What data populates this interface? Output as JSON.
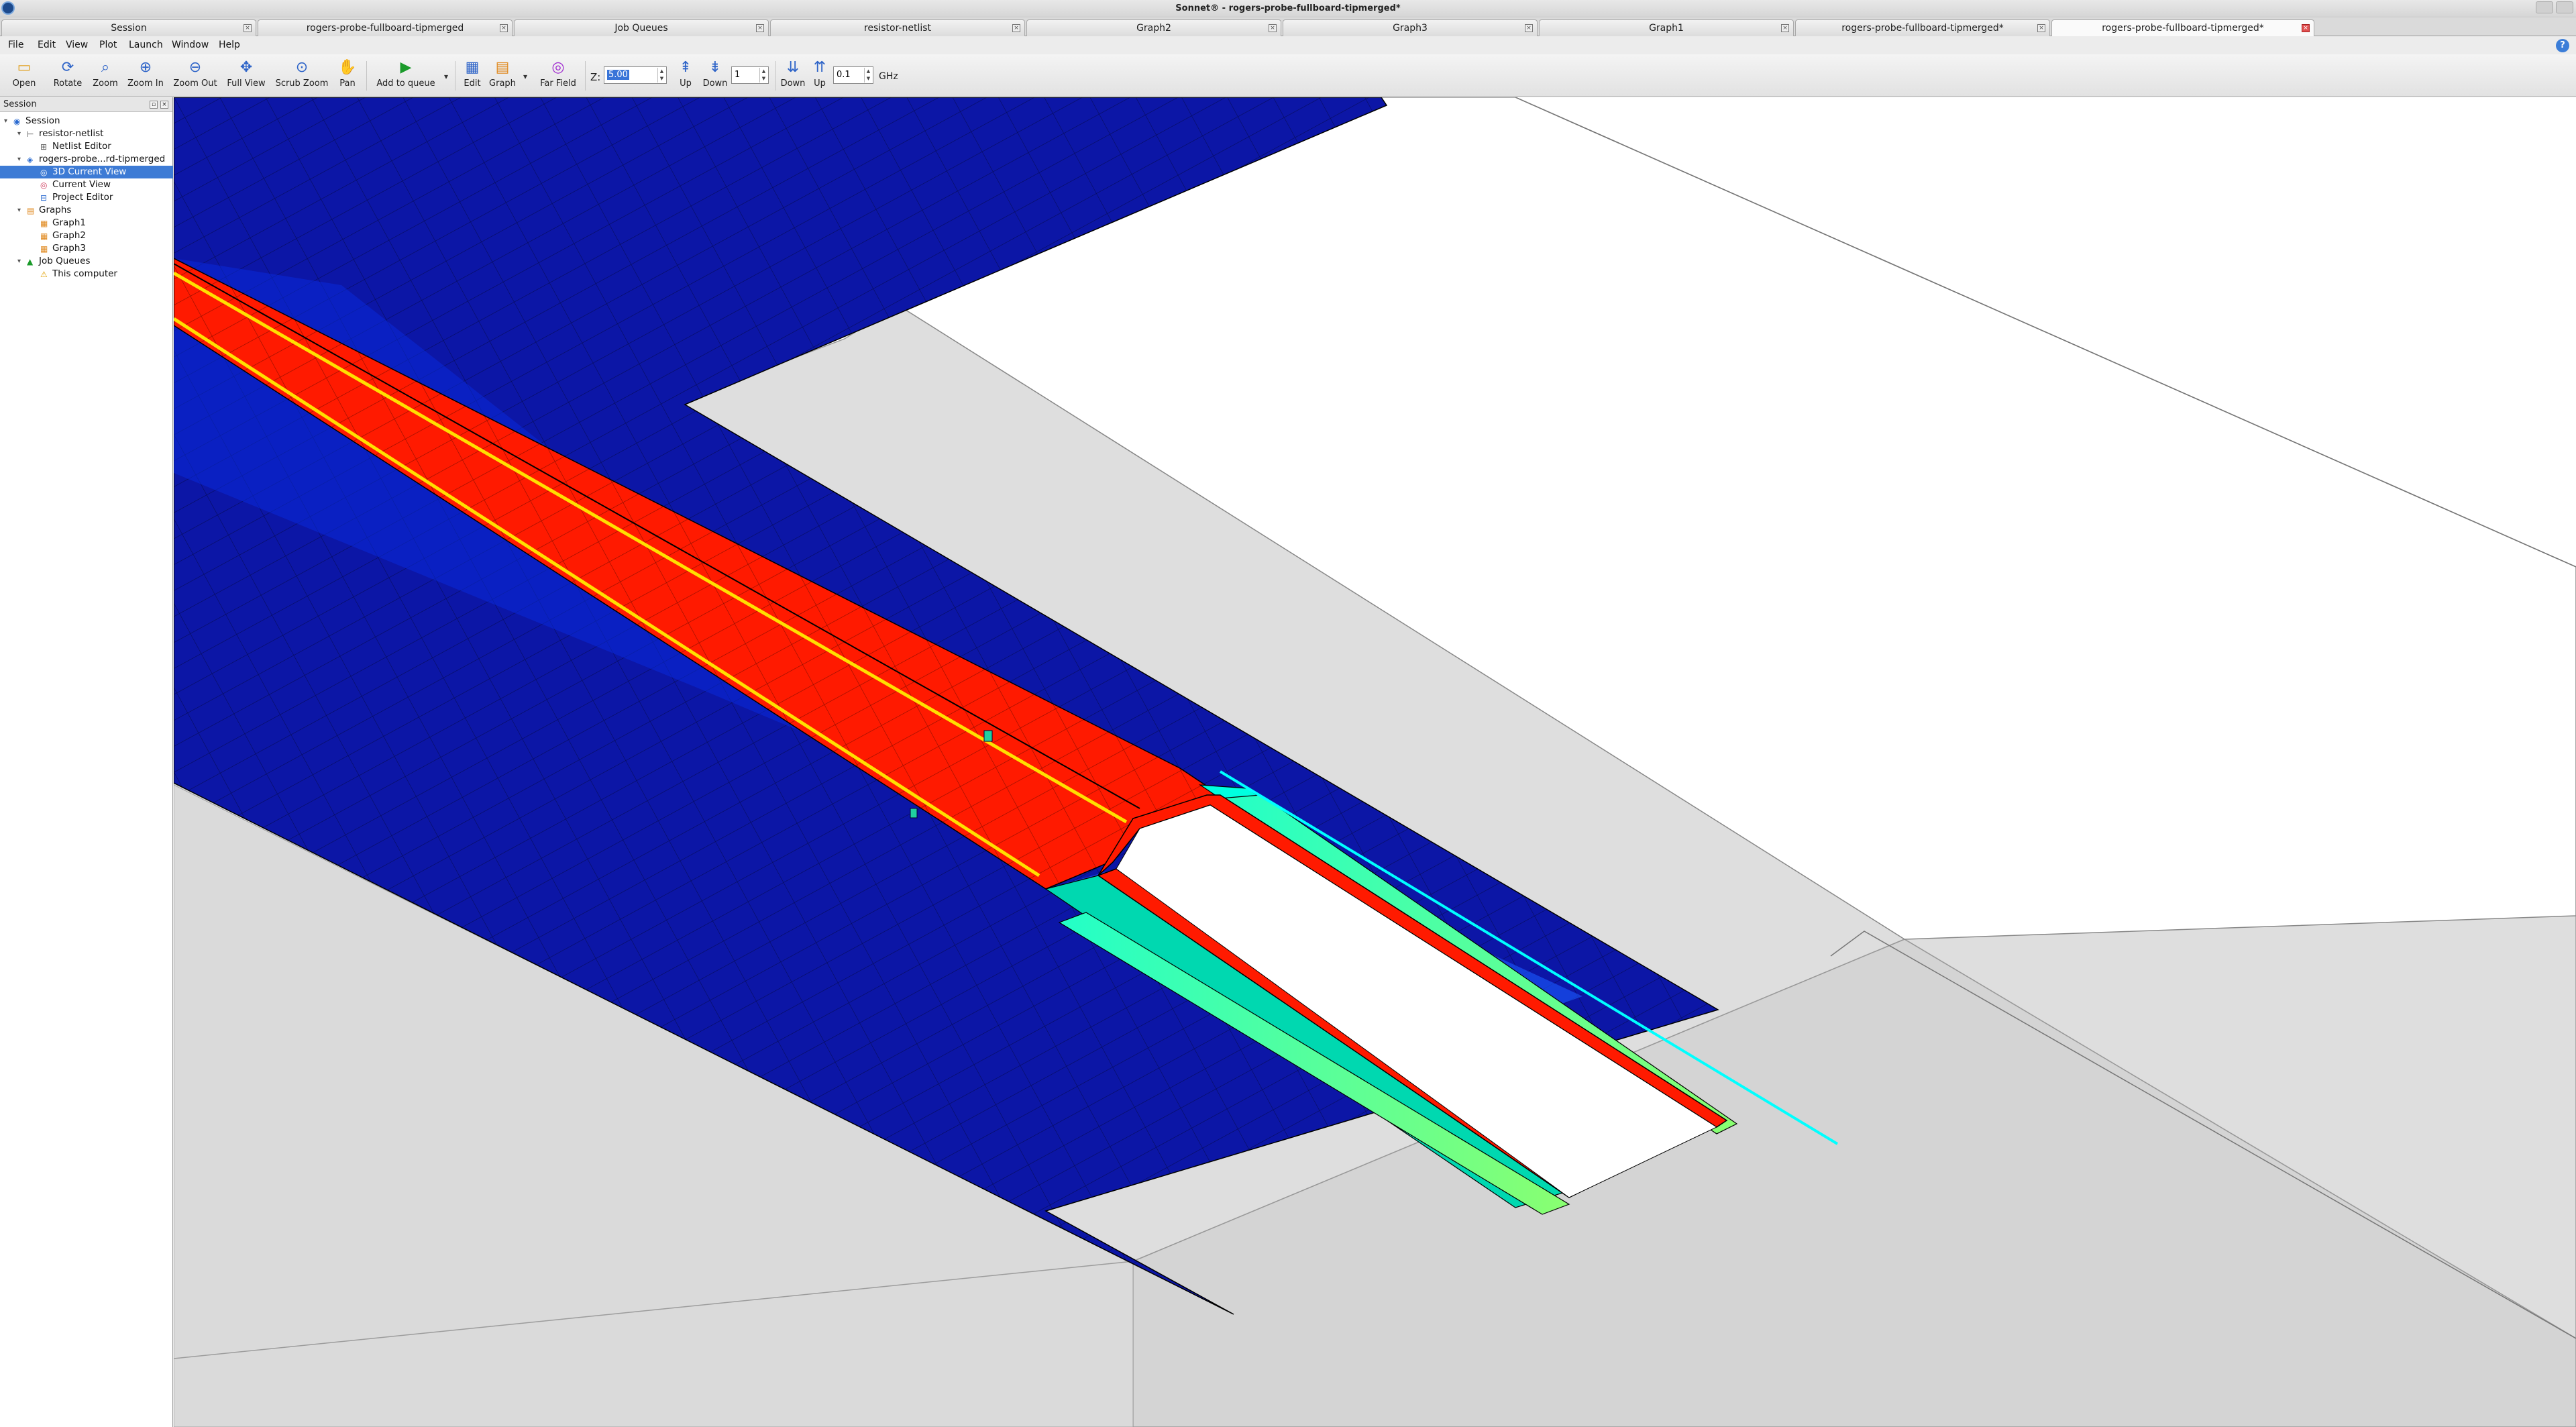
{
  "window": {
    "title": "Sonnet® - rogers-probe-fullboard-tipmerged*"
  },
  "tabs": [
    {
      "label": "Session",
      "icon": "session-icon"
    },
    {
      "label": "rogers-probe-fullboard-tipmerged",
      "icon": "netlist-icon"
    },
    {
      "label": "Job Queues",
      "icon": "job-queue-icon"
    },
    {
      "label": "resistor-netlist",
      "icon": "netlist-icon"
    },
    {
      "label": "Graph2",
      "icon": "graph-icon"
    },
    {
      "label": "Graph3",
      "icon": "graph-icon"
    },
    {
      "label": "Graph1",
      "icon": "graph-icon"
    },
    {
      "label": "rogers-probe-fullboard-tipmerged*",
      "icon": "current-view-icon"
    },
    {
      "label": "rogers-probe-fullboard-tipmerged*",
      "icon": "3d-current-view-icon"
    }
  ],
  "menu": [
    "File",
    "Edit",
    "View",
    "Plot",
    "Launch",
    "Window",
    "Help"
  ],
  "toolbar": {
    "open": "Open",
    "rotate": "Rotate",
    "zoom": "Zoom",
    "zoom_in": "Zoom In",
    "zoom_out": "Zoom Out",
    "full_view": "Full View",
    "scrub_zoom": "Scrub Zoom",
    "pan": "Pan",
    "add_to_queue": "Add to queue",
    "edit": "Edit",
    "graph": "Graph",
    "far_field": "Far Field",
    "z_label": "Z:",
    "z_value": "5.00",
    "z_up": "Up",
    "z_down": "Down",
    "level_value": "1",
    "level_down": "Down",
    "level_up": "Up",
    "freq_value": "0.1",
    "freq_unit": "GHz"
  },
  "sidebar": {
    "title": "Session",
    "tree": [
      {
        "label": "Session",
        "indent": 0,
        "icon": "session-icon",
        "expand": "open"
      },
      {
        "label": "resistor-netlist",
        "indent": 1,
        "icon": "netlist-icon",
        "expand": "open"
      },
      {
        "label": "Netlist Editor",
        "indent": 2,
        "icon": "netlist-editor-icon",
        "expand": "none"
      },
      {
        "label": "rogers-probe...rd-tipmerged",
        "indent": 1,
        "icon": "project-icon",
        "expand": "open"
      },
      {
        "label": "3D Current View",
        "indent": 2,
        "icon": "3d-current-view-icon",
        "expand": "none",
        "selected": true
      },
      {
        "label": "Current View",
        "indent": 2,
        "icon": "current-view-icon",
        "expand": "none"
      },
      {
        "label": "Project Editor",
        "indent": 2,
        "icon": "project-editor-icon",
        "expand": "none"
      },
      {
        "label": "Graphs",
        "indent": 1,
        "icon": "graphs-folder-icon",
        "expand": "open"
      },
      {
        "label": "Graph1",
        "indent": 2,
        "icon": "graph-icon",
        "expand": "none"
      },
      {
        "label": "Graph2",
        "indent": 2,
        "icon": "graph-icon",
        "expand": "none"
      },
      {
        "label": "Graph3",
        "indent": 2,
        "icon": "graph-icon",
        "expand": "none"
      },
      {
        "label": "Job Queues",
        "indent": 1,
        "icon": "job-queue-icon",
        "expand": "open"
      },
      {
        "label": "This computer",
        "indent": 2,
        "icon": "warning-icon",
        "expand": "none"
      }
    ]
  },
  "colors": {
    "current_high": "#ff1a00",
    "current_mid": "#00ffe0",
    "current_low": "#0010a0",
    "substrate": "#dedede",
    "selection": "#3d7bd5"
  }
}
